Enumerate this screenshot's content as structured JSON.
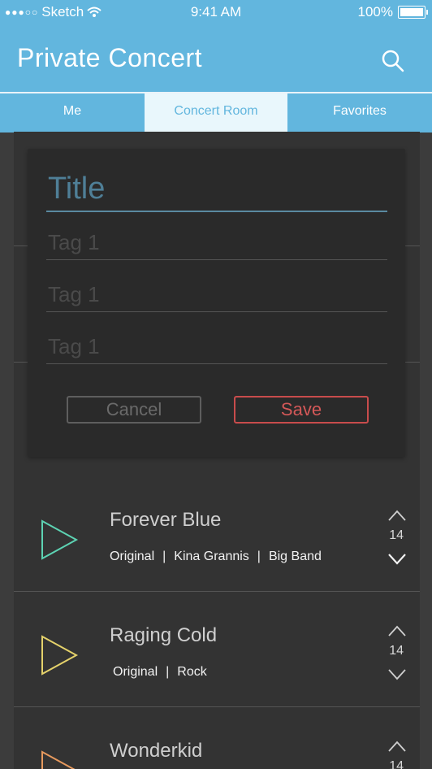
{
  "status": {
    "carrier": "Sketch",
    "time": "9:41 AM",
    "battery": "100%"
  },
  "header": {
    "title": "Private Concert"
  },
  "tabs": [
    {
      "label": "Me"
    },
    {
      "label": "Concert Room",
      "active": true
    },
    {
      "label": "Favorites"
    }
  ],
  "form": {
    "title_placeholder": "Title",
    "tag_placeholders": [
      "Tag 1",
      "Tag 1",
      "Tag 1"
    ],
    "cancel_label": "Cancel",
    "save_label": "Save"
  },
  "songs": [
    {
      "name": "Forever Blue",
      "meta": [
        "Original",
        "Kina Grannis",
        "Big Band"
      ],
      "votes": "14",
      "play_color": "#5dd3b3"
    },
    {
      "name": "Raging Cold",
      "meta": [
        "Original",
        "Rock"
      ],
      "votes": "14",
      "play_color": "#e5d26b"
    },
    {
      "name": "Wonderkid",
      "meta": [],
      "votes": "14",
      "play_color": "#e79a5e"
    }
  ],
  "colors": {
    "accent": "#62b6de",
    "save": "#c84c4c",
    "background": "#333333"
  }
}
